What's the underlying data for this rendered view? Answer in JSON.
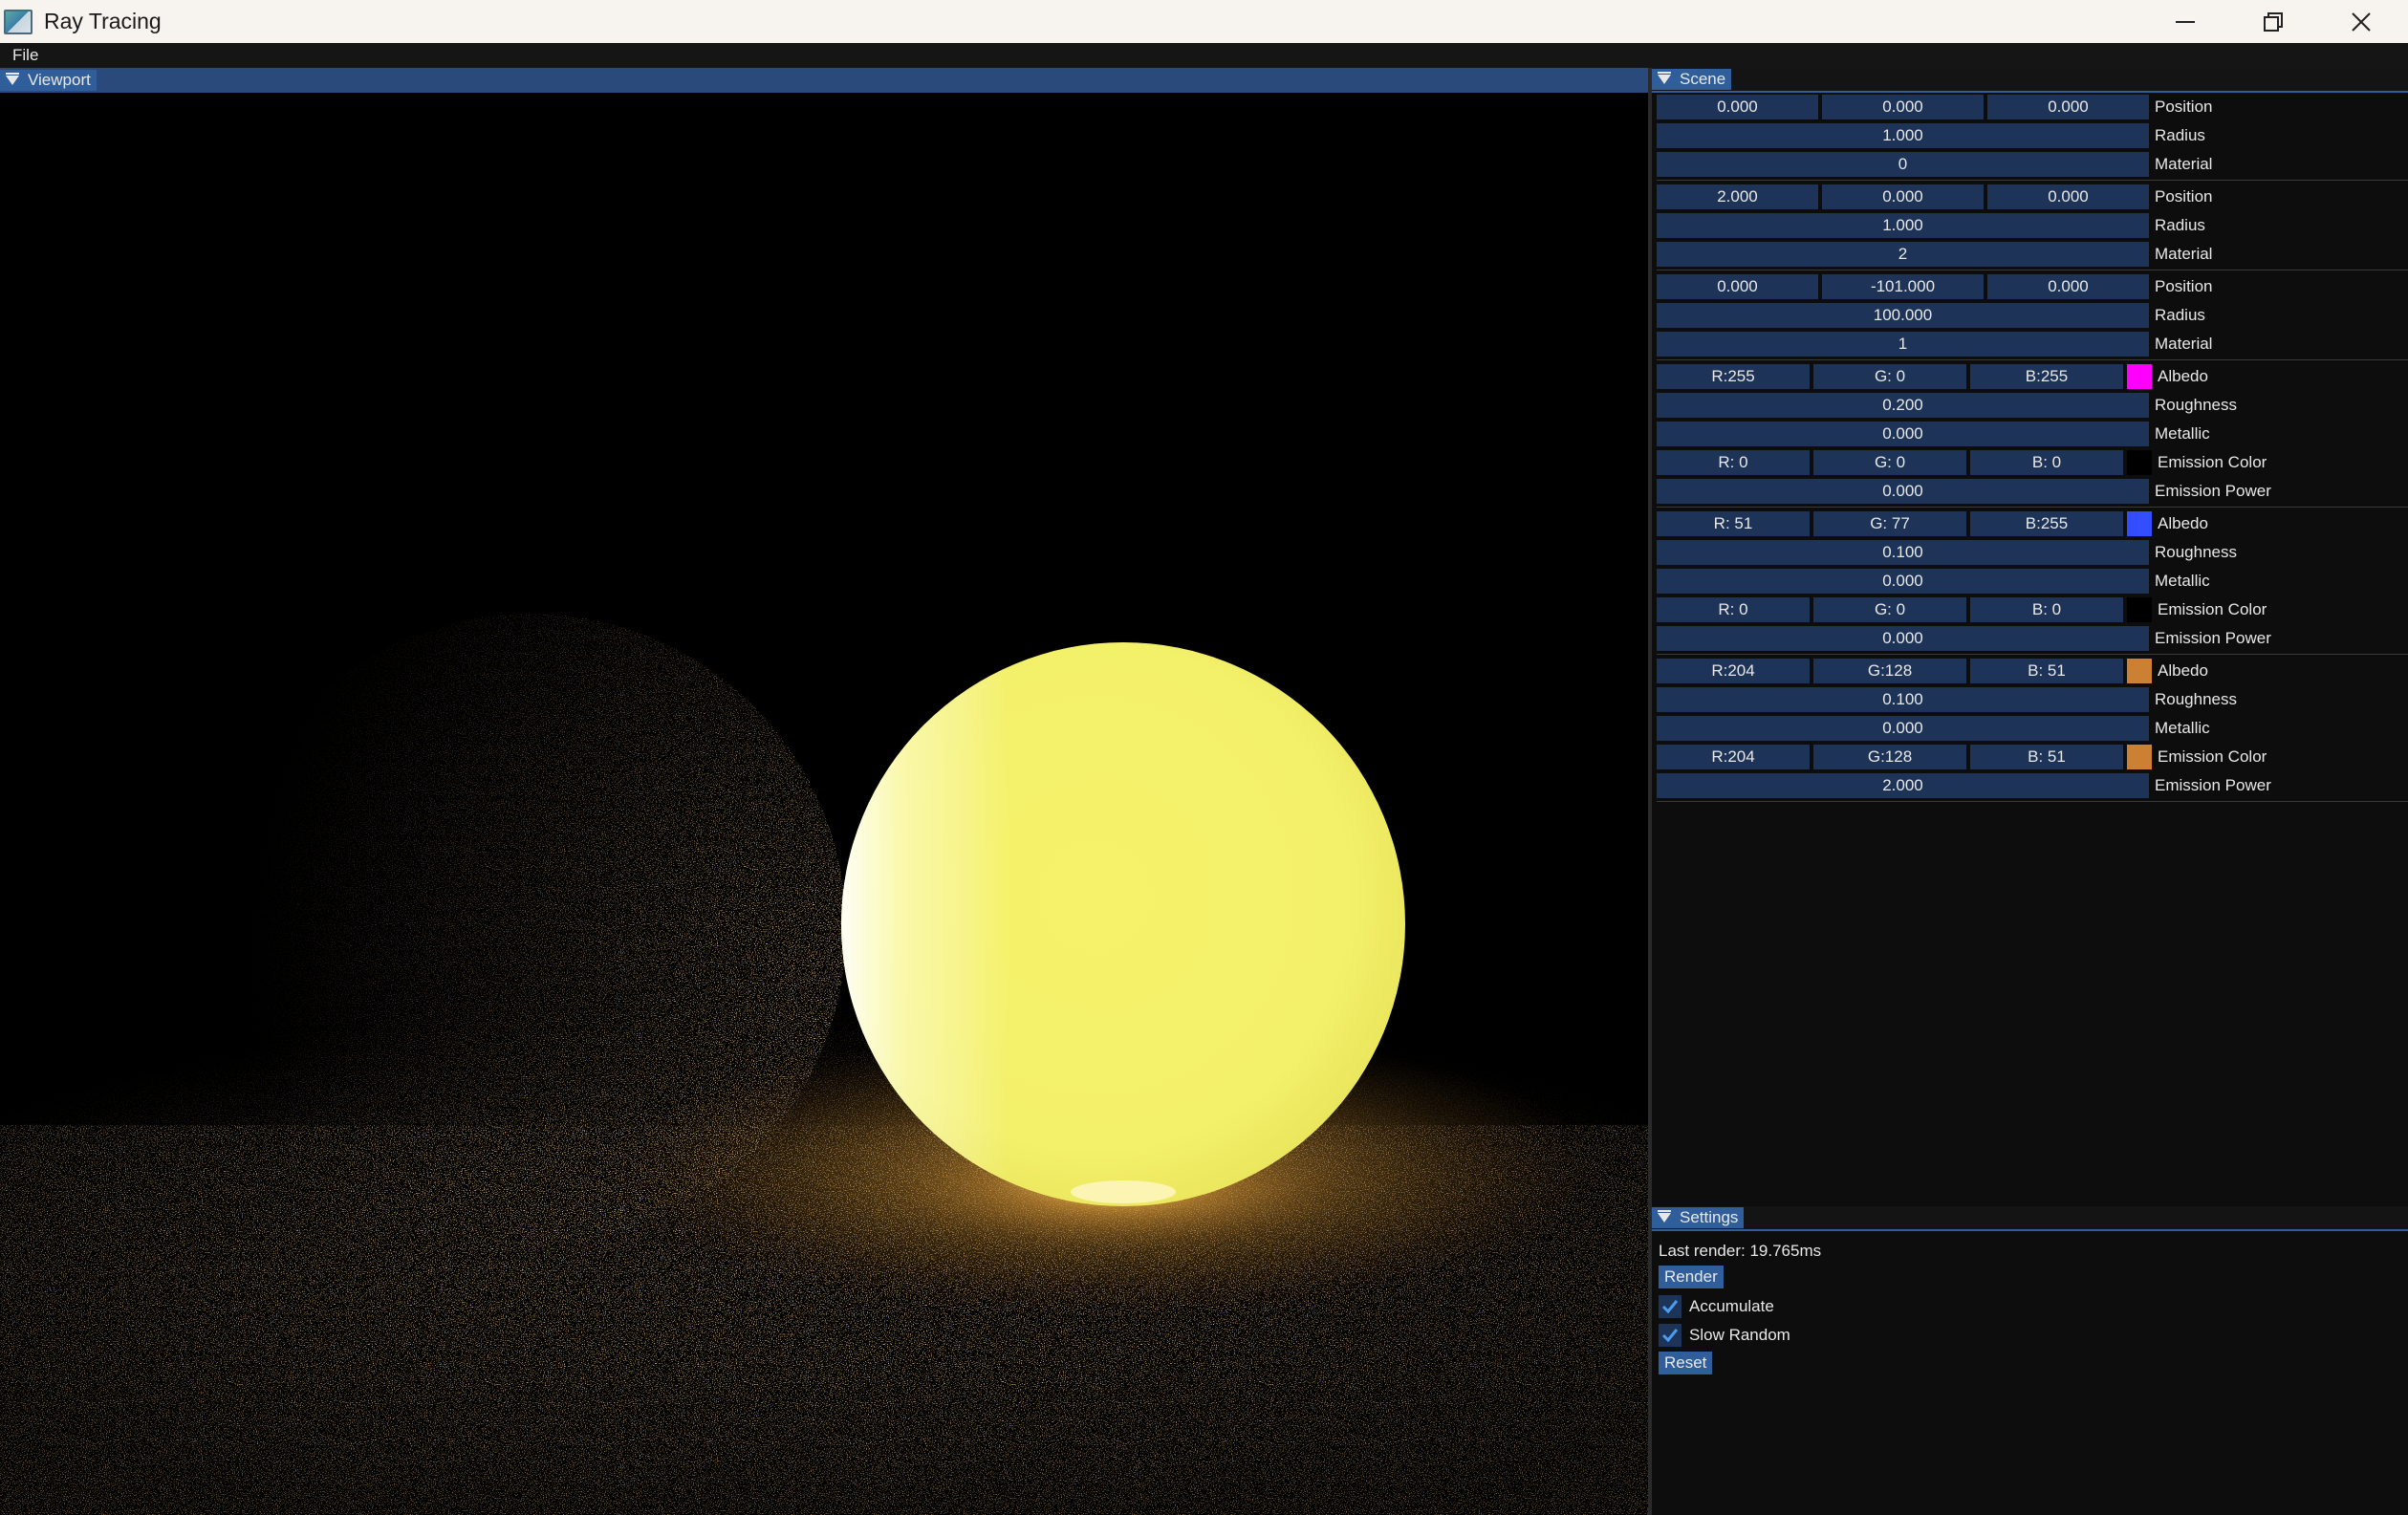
{
  "window": {
    "title": "Ray Tracing",
    "icon": "app-window-icon",
    "controls": [
      "minimize-icon",
      "restore-icon",
      "close-icon"
    ]
  },
  "menu": {
    "file": "File"
  },
  "viewport": {
    "tab_label": "Viewport"
  },
  "scene": {
    "tab_label": "Scene",
    "spheres": [
      {
        "position": [
          "0.000",
          "0.000",
          "0.000"
        ],
        "radius": "1.000",
        "material": "0"
      },
      {
        "position": [
          "2.000",
          "0.000",
          "0.000"
        ],
        "radius": "1.000",
        "material": "2"
      },
      {
        "position": [
          "0.000",
          "-101.000",
          "0.000"
        ],
        "radius": "100.000",
        "material": "1"
      }
    ],
    "materials": [
      {
        "albedo": [
          "R:255",
          "G:  0",
          "B:255"
        ],
        "albedo_color": "#ff00ff",
        "roughness": "0.200",
        "metallic": "0.000",
        "emission_color": [
          "R:  0",
          "G:  0",
          "B:  0"
        ],
        "emission_swatch": "#000000",
        "emission_power": "0.000"
      },
      {
        "albedo": [
          "R: 51",
          "G: 77",
          "B:255"
        ],
        "albedo_color": "#334dff",
        "roughness": "0.100",
        "metallic": "0.000",
        "emission_color": [
          "R:  0",
          "G:  0",
          "B:  0"
        ],
        "emission_swatch": "#000000",
        "emission_power": "0.000"
      },
      {
        "albedo": [
          "R:204",
          "G:128",
          "B: 51"
        ],
        "albedo_color": "#cc8033",
        "roughness": "0.100",
        "metallic": "0.000",
        "emission_color": [
          "R:204",
          "G:128",
          "B: 51"
        ],
        "emission_swatch": "#cc8033",
        "emission_power": "2.000"
      }
    ],
    "labels": {
      "position": "Position",
      "radius": "Radius",
      "material": "Material",
      "albedo": "Albedo",
      "roughness": "Roughness",
      "metallic": "Metallic",
      "emission_color": "Emission Color",
      "emission_power": "Emission Power"
    }
  },
  "settings": {
    "tab_label": "Settings",
    "last_render": "Last render: 19.765ms",
    "render_button": "Render",
    "accumulate": {
      "label": "Accumulate",
      "checked": true
    },
    "slow_random": {
      "label": "Slow Random",
      "checked": true
    },
    "reset_button": "Reset"
  },
  "colors": {
    "accent": "#2f5e9b",
    "field_bg": "#1d3358"
  }
}
